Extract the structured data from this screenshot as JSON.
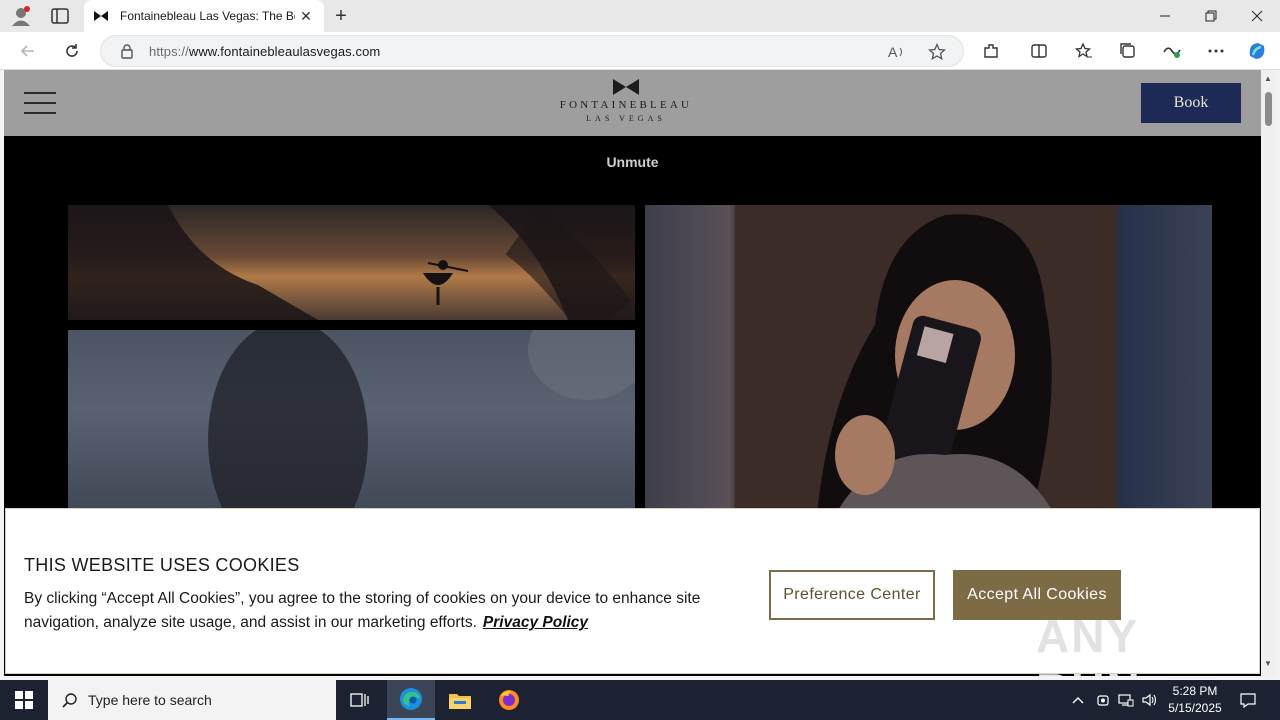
{
  "browser": {
    "tab": {
      "title": "Fontainebleau Las Vegas: The Best",
      "favicon": "bowtie-icon"
    },
    "address": {
      "protocol": "https://",
      "domain": "www.fontainebleaulasvegas.com"
    },
    "window_controls": [
      "minimize-icon",
      "restore-icon",
      "close-icon"
    ]
  },
  "site": {
    "logo": {
      "name": "FONTAINEBLEAU",
      "sub": "LAS VEGAS"
    },
    "book_label": "Book",
    "unmute_label": "Unmute"
  },
  "cookie": {
    "title": "THIS WEBSITE USES COOKIES",
    "text": "By clicking “Accept All Cookies”, you agree to the storing of cookies on your device to enhance site navigation, analyze site usage, and assist in our marketing efforts.",
    "privacy_link": "Privacy Policy",
    "preference_label": "Preference Center",
    "accept_label": "Accept All Cookies"
  },
  "watermark": "ANY RUN",
  "taskbar": {
    "search_placeholder": "Type here to search",
    "time": "5:28 PM",
    "date": "5/15/2025"
  },
  "colors": {
    "book_button": "#1c2a55",
    "accent_gold": "#7c6b44",
    "header_bg": "#9e9e9e",
    "taskbar_bg": "#1c2231"
  }
}
